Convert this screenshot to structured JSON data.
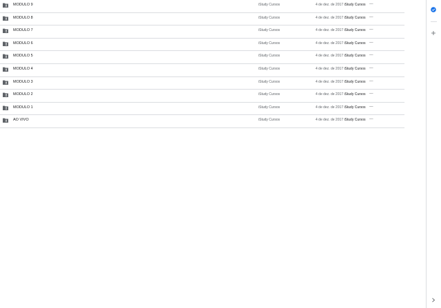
{
  "files": [
    {
      "name": "MODULO 9",
      "owner": "iStudy Cursos",
      "modified_date": "4 de dez. de 2017",
      "modified_by": "iStudy Cursos",
      "size": "—"
    },
    {
      "name": "MODULO 8",
      "owner": "iStudy Cursos",
      "modified_date": "4 de dez. de 2017",
      "modified_by": "iStudy Cursos",
      "size": "—"
    },
    {
      "name": "MODULO 7",
      "owner": "iStudy Cursos",
      "modified_date": "4 de dez. de 2017",
      "modified_by": "iStudy Cursos",
      "size": "—"
    },
    {
      "name": "MODULO 6",
      "owner": "iStudy Cursos",
      "modified_date": "4 de dez. de 2017",
      "modified_by": "iStudy Cursos",
      "size": "—"
    },
    {
      "name": "MODULO 5",
      "owner": "iStudy Cursos",
      "modified_date": "4 de dez. de 2017",
      "modified_by": "iStudy Cursos",
      "size": "—"
    },
    {
      "name": "MODULO 4",
      "owner": "iStudy Cursos",
      "modified_date": "4 de dez. de 2017",
      "modified_by": "iStudy Cursos",
      "size": "—"
    },
    {
      "name": "MODULO 3",
      "owner": "iStudy Cursos",
      "modified_date": "4 de dez. de 2017",
      "modified_by": "iStudy Cursos",
      "size": "—"
    },
    {
      "name": "MODULO 2",
      "owner": "iStudy Cursos",
      "modified_date": "4 de dez. de 2017",
      "modified_by": "iStudy Cursos",
      "size": "—"
    },
    {
      "name": "MODULO 1",
      "owner": "iStudy Cursos",
      "modified_date": "4 de dez. de 2017",
      "modified_by": "iStudy Cursos",
      "size": "—"
    },
    {
      "name": "AO VIVO",
      "owner": "iStudy Cursos",
      "modified_date": "4 de dez. de 2017",
      "modified_by": "iStudy Cursos",
      "size": "—"
    }
  ],
  "icons": {
    "row": "shared-folder-icon",
    "side_panel": [
      "check-circle-icon",
      "add-icon",
      "chevron-right-icon"
    ]
  },
  "colors": {
    "accent": "#1a73e8",
    "folder": "#5f6368",
    "divider": "#dadce0"
  }
}
